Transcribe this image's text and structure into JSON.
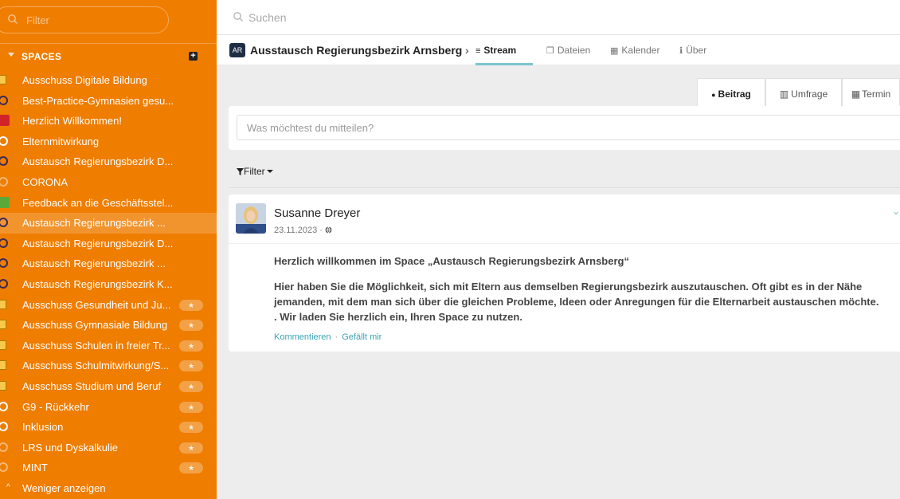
{
  "sidebar": {
    "filter_placeholder": "Filter",
    "spaces_label": "SPACES",
    "add_label": "+",
    "items": [
      {
        "label": "Ausschuss Digitale Bildung",
        "bullet": "square",
        "fav": false,
        "active": false
      },
      {
        "label": "Best-Practice-Gymnasien gesu...",
        "bullet": "ring-dark",
        "fav": false,
        "active": false
      },
      {
        "label": "Herzlich Willkommen!",
        "bullet": "img1",
        "fav": false,
        "active": false
      },
      {
        "label": "Elternmitwirkung",
        "bullet": "ring",
        "fav": false,
        "active": false
      },
      {
        "label": "Austausch Regierungsbezirk D...",
        "bullet": "ring-dark",
        "fav": false,
        "active": false
      },
      {
        "label": "CORONA",
        "bullet": "ring-faint",
        "fav": false,
        "active": false
      },
      {
        "label": "Feedback an die Geschäftsstel...",
        "bullet": "img2",
        "fav": false,
        "active": false
      },
      {
        "label": "Austausch Regierungsbezirk ...",
        "bullet": "ring-dark",
        "fav": false,
        "active": true
      },
      {
        "label": "Austausch Regierungsbezirk D...",
        "bullet": "ring-dark",
        "fav": false,
        "active": false
      },
      {
        "label": "Austausch Regierungsbezirk ...",
        "bullet": "ring-dark",
        "fav": false,
        "active": false
      },
      {
        "label": "Austausch Regierungsbezirk K...",
        "bullet": "ring-dark",
        "fav": false,
        "active": false
      },
      {
        "label": "Ausschuss Gesundheit und Ju...",
        "bullet": "square",
        "fav": true,
        "active": false
      },
      {
        "label": "Ausschuss Gymnasiale Bildung",
        "bullet": "square",
        "fav": true,
        "active": false
      },
      {
        "label": "Ausschuss Schulen in freier Tr...",
        "bullet": "square",
        "fav": true,
        "active": false
      },
      {
        "label": "Ausschuss Schulmitwirkung/S...",
        "bullet": "square",
        "fav": true,
        "active": false
      },
      {
        "label": "Ausschuss Studium und Beruf",
        "bullet": "square",
        "fav": true,
        "active": false
      },
      {
        "label": "G9 - Rückkehr",
        "bullet": "ring",
        "fav": true,
        "active": false
      },
      {
        "label": "Inklusion",
        "bullet": "ring",
        "fav": true,
        "active": false
      },
      {
        "label": "LRS und Dyskalkulie",
        "bullet": "ring-faint",
        "fav": true,
        "active": false
      },
      {
        "label": "MINT",
        "bullet": "ring-faint",
        "fav": true,
        "active": false
      }
    ],
    "show_less": "Weniger anzeigen",
    "fav_glyph": "★"
  },
  "topbar": {
    "search_placeholder": "Suchen"
  },
  "space": {
    "badge": "AR",
    "title": "Ausstausch Regierungsbezirk Arnsberg",
    "separator": "›",
    "tabs": [
      {
        "label": "Stream",
        "icon": "≡"
      },
      {
        "label": "Dateien",
        "icon": "❐"
      },
      {
        "label": "Kalender",
        "icon": "▦"
      },
      {
        "label": "Über",
        "icon": "ℹ"
      }
    ]
  },
  "composer": {
    "tabs": [
      {
        "label": "Beitrag",
        "icon": "●"
      },
      {
        "label": "Umfrage",
        "icon": "▥"
      },
      {
        "label": "Termin",
        "icon": "▦"
      }
    ],
    "placeholder": "Was möchtest du mitteilen?"
  },
  "filter_label": "Filter",
  "post": {
    "author": "Susanne Dreyer",
    "date": "23.11.2023 · ",
    "visibility_icon": "globe-icon",
    "heading": "Herzlich willkommen im Space „Austausch Regierungsbezirk Arnsberg“",
    "body": "Hier haben Sie die Möglichkeit, sich mit Eltern aus demselben Regierungsbezirk auszutauschen. Oft gibt es in der Nähe jemanden, mit dem man sich über die gleichen Probleme, Ideen oder Anregungen für die Elternarbeit austauschen möchte. . Wir laden Sie herzlich ein, Ihren Space zu nutzen.",
    "comment_label": "Kommentieren",
    "separator": "·",
    "like_label": "Gefällt mir"
  },
  "colors": {
    "sidebar": "#ef7d00",
    "accent": "#7cc4cf",
    "link": "#3aa3b5",
    "badge": "#1f2e45"
  }
}
